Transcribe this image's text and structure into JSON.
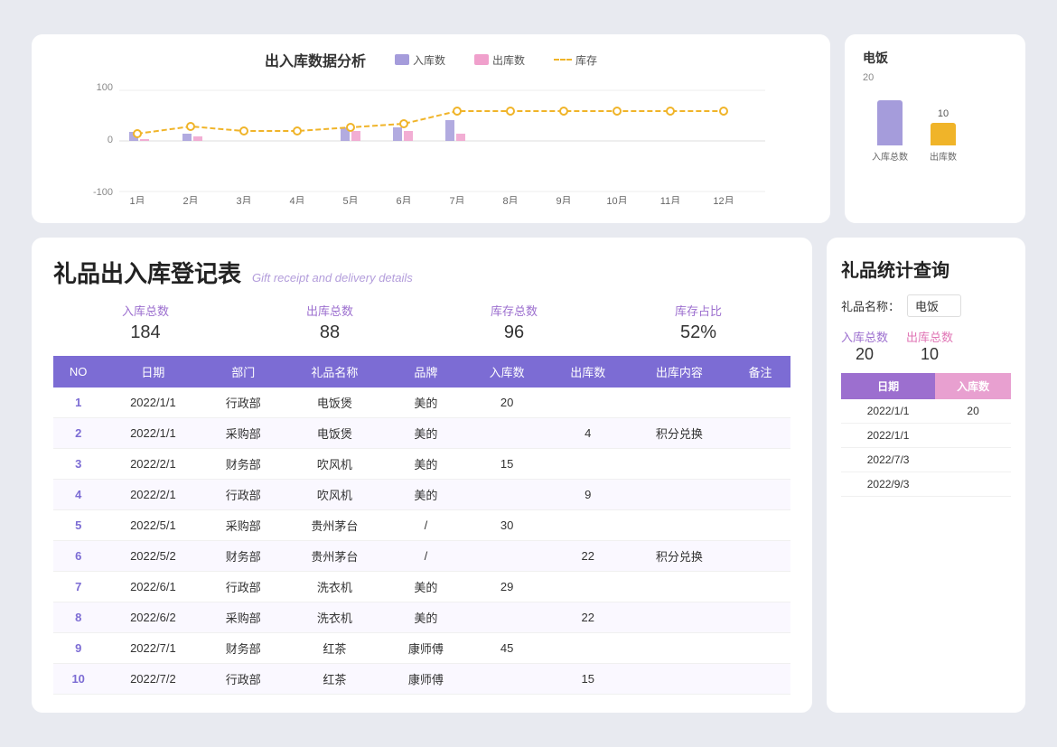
{
  "topChart": {
    "title": "出入库数据分析",
    "legend": [
      {
        "label": "入库数",
        "type": "box",
        "color": "#a59cdb"
      },
      {
        "label": "出库数",
        "type": "box",
        "color": "#f0a0cc"
      },
      {
        "label": "库存",
        "type": "line",
        "color": "#f0b429"
      }
    ],
    "months": [
      "1月",
      "2月",
      "3月",
      "4月",
      "5月",
      "6月",
      "7月",
      "8月",
      "9月",
      "10月",
      "11月",
      "12月"
    ],
    "inData": [
      20,
      15,
      0,
      0,
      30,
      29,
      45,
      0,
      0,
      0,
      0,
      0
    ],
    "outData": [
      4,
      0,
      9,
      0,
      22,
      22,
      15,
      0,
      0,
      0,
      0,
      0
    ],
    "stockData": [
      16,
      31,
      22,
      22,
      30,
      37,
      67,
      67,
      67,
      67,
      67,
      67
    ]
  },
  "rightSmallChart": {
    "title": "电饭",
    "inLabel": "入库总数",
    "outLabel": "出库数",
    "inValue": 20,
    "outValue": 10,
    "inColor": "#a59cdb",
    "outColor": "#f0b429"
  },
  "leftPanel": {
    "titleZh": "礼品出入库登记表",
    "titleEn": "Gift receipt and delivery details",
    "stats": [
      {
        "label": "入库总数",
        "value": "184"
      },
      {
        "label": "出库总数",
        "value": "88"
      },
      {
        "label": "库存总数",
        "value": "96"
      },
      {
        "label": "库存占比",
        "value": "52%"
      }
    ],
    "tableHeaders": [
      "NO",
      "日期",
      "部门",
      "礼品名称",
      "品牌",
      "入库数",
      "出库数",
      "出库内容",
      "备注"
    ],
    "tableRows": [
      [
        "1",
        "2022/1/1",
        "行政部",
        "电饭煲",
        "美的",
        "20",
        "",
        "",
        ""
      ],
      [
        "2",
        "2022/1/1",
        "采购部",
        "电饭煲",
        "美的",
        "",
        "4",
        "积分兑换",
        ""
      ],
      [
        "3",
        "2022/2/1",
        "财务部",
        "吹风机",
        "美的",
        "15",
        "",
        "",
        ""
      ],
      [
        "4",
        "2022/2/1",
        "行政部",
        "吹风机",
        "美的",
        "",
        "9",
        "",
        ""
      ],
      [
        "5",
        "2022/5/1",
        "采购部",
        "贵州茅台",
        "/",
        "30",
        "",
        "",
        ""
      ],
      [
        "6",
        "2022/5/2",
        "财务部",
        "贵州茅台",
        "/",
        "",
        "22",
        "积分兑换",
        ""
      ],
      [
        "7",
        "2022/6/1",
        "行政部",
        "洗衣机",
        "美的",
        "29",
        "",
        "",
        ""
      ],
      [
        "8",
        "2022/6/2",
        "采购部",
        "洗衣机",
        "美的",
        "",
        "22",
        "",
        ""
      ],
      [
        "9",
        "2022/7/1",
        "财务部",
        "红茶",
        "康师傅",
        "45",
        "",
        "",
        ""
      ],
      [
        "10",
        "2022/7/2",
        "行政部",
        "红茶",
        "康师傅",
        "",
        "15",
        "",
        ""
      ]
    ]
  },
  "rightPanel": {
    "title": "礼品统计查询",
    "giftNameLabel": "礼品名称：",
    "giftNameValue": "电饭",
    "inLabel": "入库总数",
    "outLabel": "出库总数",
    "inValue": "20",
    "outValue": "10",
    "tableHeaders": [
      "日期",
      "入库数"
    ],
    "tableRows": [
      [
        "2022/1/1",
        "20"
      ],
      [
        "2022/1/1",
        ""
      ],
      [
        "2022/7/3",
        ""
      ],
      [
        "2022/9/3",
        ""
      ]
    ]
  }
}
